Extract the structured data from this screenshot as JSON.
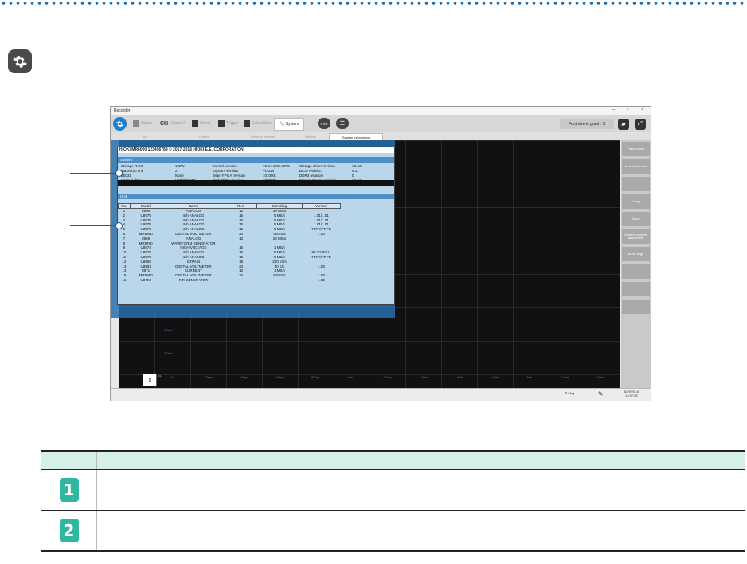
{
  "window": {
    "title": "Recorder"
  },
  "toolbar": {
    "status": "Status",
    "channel_icon_text": "CH",
    "channel": "Channel",
    "sheet": "Sheet",
    "trigger": "Trigger",
    "calculation": "Calculation",
    "system": "System",
    "func": "Func",
    "font_size": "Font size in graph: S"
  },
  "tabs": [
    "Sys",
    "Comm",
    "External terminal",
    "Initialize",
    "System information"
  ],
  "sysinfo": {
    "header": "HIOKI  MR6000  123456789        © 2017-2018 HIOKI E.E. CORPORATION",
    "system_title": "System",
    "system_rows": [
      [
        "Storage RAM",
        "1 GW",
        "Kernel version",
        "10.0.14393.1715",
        "Storage driver revision",
        "V0.10"
      ],
      [
        "Maximum unit",
        "27",
        "System version",
        "V0.11a",
        "BIOS revision",
        "5.11"
      ],
      [
        "Z5031",
        "None",
        "Main FPGA revision",
        "1010001",
        "DDR3 revision",
        "0"
      ],
      [
        "Internal drive",
        "U8332(SSD)",
        "Sub FPGA revision",
        "1000001",
        "Microcomputer revision",
        "V0.12"
      ]
    ],
    "unit_title": "Unit",
    "unit_headers": [
      "No.",
      "Model",
      "Name",
      "Res.",
      "Sampling",
      "Version"
    ],
    "units": [
      [
        "1",
        "8966",
        "ANALOG",
        "12",
        "20 MS/s",
        ""
      ],
      [
        "2",
        "U8975",
        "4ch ANALOG",
        "16",
        "5 MS/s",
        "1.01/1.01"
      ],
      [
        "3",
        "U8975",
        "4ch ANALOG",
        "16",
        "5 MS/s",
        "1.01/1.01"
      ],
      [
        "4",
        "U8975",
        "4ch ANALOG",
        "16",
        "5 MS/s",
        "1.01/1.01"
      ],
      [
        "5",
        "U8975",
        "4ch ANALOG",
        "16",
        "5 MS/s",
        "7F.FE/7F.FE"
      ],
      [
        "6",
        "MR8990",
        "DIGITAL VOLTMETER",
        "24",
        "500 S/s",
        "1.03"
      ],
      [
        "7",
        "8966",
        "ANALOG",
        "12",
        "20 MS/s",
        ""
      ],
      [
        "8",
        "MR8790",
        "WAVEFORM GENERATOR",
        "",
        "",
        ""
      ],
      [
        "9",
        "U8974",
        "HIGH VOLTAGE",
        "16",
        "1 MS/s",
        ""
      ],
      [
        "10",
        "U8975",
        "4ch ANALOG",
        "16",
        "5 MS/s",
        "80.1D/80.11"
      ],
      [
        "11",
        "U8975",
        "4ch ANALOG",
        "16",
        "5 MS/s",
        "7F.FE/7F.FE"
      ],
      [
        "12",
        "U8969",
        "STRAIN",
        "16",
        "200 kS/s",
        ""
      ],
      [
        "13",
        "U8991",
        "DIGITAL VOLTMETER",
        "24",
        "50 S/s",
        "1.03"
      ],
      [
        "14",
        "8971",
        "CURRENT",
        "12",
        "1 MS/s",
        ""
      ],
      [
        "15",
        "MR8990",
        "DIGITAL VOLTMETER",
        "24",
        "500 S/s",
        "1.03"
      ],
      [
        "16",
        "U8794",
        "F/R GENERATOR",
        "",
        "",
        "1.02"
      ]
    ]
  },
  "graph": {
    "y_labels": [
      "-60mV",
      "-80mV"
    ],
    "x_labels": [
      "0s",
      "200μs",
      "400μs",
      "600μs",
      "800μs",
      "1ms",
      "1.2ms",
      "1.4ms",
      "1.6ms",
      "1.8ms",
      "2ms",
      "2.2ms",
      "2.4ms"
    ]
  },
  "right_panel": [
    "Trace cursor",
    "Horizontal cursor",
    "",
    "Gauge",
    "Zoom",
    "Channel position adjustment",
    "Auto range",
    "",
    "",
    ""
  ],
  "status": {
    "date": "8/29/2018",
    "time": "12:57:52",
    "mag_label": "Mag"
  },
  "legend": {
    "rows": [
      {
        "num": "1",
        "name": "",
        "desc": ""
      },
      {
        "num": "2",
        "name": "",
        "desc": ""
      }
    ]
  },
  "colors": {
    "accent": "#1a7fd0",
    "teal": "#2fb7a0",
    "header_bg": "#d6efe9",
    "dots": "#1a6fb0"
  }
}
